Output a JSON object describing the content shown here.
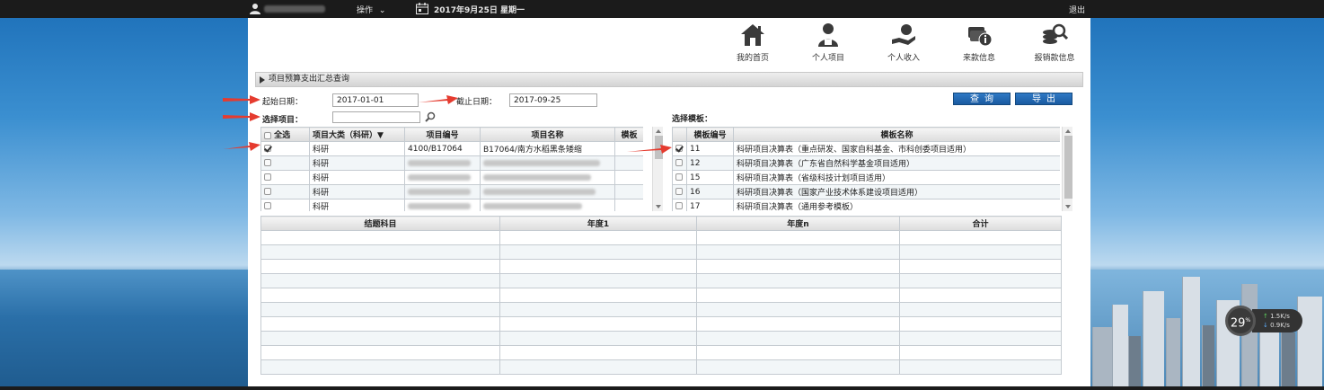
{
  "topbar": {
    "operate_label": "操作",
    "operate_chevron": "⌄",
    "date_label": "2017年9月25日 星期一",
    "logout_label": "退出"
  },
  "nav": {
    "items": [
      {
        "label": "我的首页",
        "icon": "home-icon"
      },
      {
        "label": "个人项目",
        "icon": "person-project-icon"
      },
      {
        "label": "个人收入",
        "icon": "income-icon"
      },
      {
        "label": "来款信息",
        "icon": "money-info-icon"
      },
      {
        "label": "报销款信息",
        "icon": "reimburse-search-icon"
      }
    ]
  },
  "section": {
    "title": "项目预算支出汇总查询"
  },
  "filters": {
    "start_label": "起始日期：",
    "start_value": "2017-01-01",
    "end_label": "截止日期：",
    "end_value": "2017-09-25",
    "project_label": "选择项目：",
    "project_value": "",
    "template_label": "选择模板：",
    "query_button": "查询",
    "export_button": "导出"
  },
  "projects_table": {
    "headers": [
      "全选",
      "项目大类（科研）▼",
      "项目编号",
      "项目名称",
      "模板"
    ],
    "rows": [
      {
        "checked": true,
        "category": "科研",
        "code": "4100/B17064",
        "name": "B17064/南方水稻黑条矮缩"
      },
      {
        "checked": false,
        "category": "科研"
      },
      {
        "checked": false,
        "category": "科研"
      },
      {
        "checked": false,
        "category": "科研"
      },
      {
        "checked": false,
        "category": "科研"
      }
    ]
  },
  "templates_table": {
    "headers": [
      "模板编号",
      "模板名称"
    ],
    "rows": [
      {
        "checked": true,
        "code": "11",
        "name": "科研项目决算表（重点研发、国家自科基金、市科创委项目适用）"
      },
      {
        "checked": false,
        "code": "12",
        "name": "科研项目决算表（广东省自然科学基金项目适用）"
      },
      {
        "checked": false,
        "code": "15",
        "name": "科研项目决算表（省级科技计划项目适用）"
      },
      {
        "checked": false,
        "code": "16",
        "name": "科研项目决算表（国家产业技术体系建设项目适用）"
      },
      {
        "checked": false,
        "code": "17",
        "name": "科研项目决算表（通用参考模板）"
      }
    ]
  },
  "results_table": {
    "headers": [
      "结题科目",
      "年度1",
      "年度n",
      "合计"
    ],
    "row_count": 10
  },
  "net_widget": {
    "percent": "29",
    "percent_unit": "%",
    "up": "1.5K/s",
    "down": "0.9K/s"
  },
  "colors": {
    "button_blue": "#1f63ad",
    "arrow_red": "#e53b2f",
    "topbar": "#1b1b1b"
  }
}
